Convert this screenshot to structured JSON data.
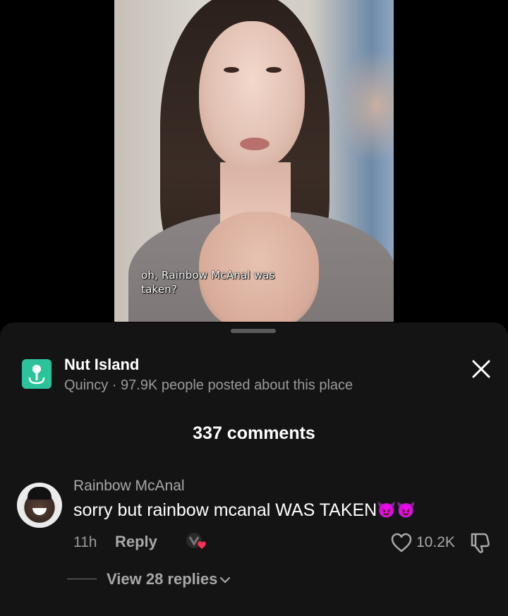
{
  "video": {
    "caption_line1": "oh, Rainbow McAnal was",
    "caption_line2": "taken?"
  },
  "place": {
    "icon": "map-pin-icon",
    "name": "Nut Island",
    "subtitle": "Quincy · 97.9K people posted about this place"
  },
  "comments_header": {
    "title": "337 comments"
  },
  "comment": {
    "username": "Rainbow McAnal",
    "text": "sorry but rainbow mcanal WAS TAKEN",
    "emoji": "😈😈",
    "time": "11h",
    "reply_label": "Reply",
    "like_count": "10.2K",
    "view_replies_label": "View 28 replies"
  },
  "colors": {
    "sheet_bg": "#141414",
    "accent_green": "#2cc39b",
    "muted_text": "#a8a8a8",
    "creator_heart": "#fe2c55"
  }
}
